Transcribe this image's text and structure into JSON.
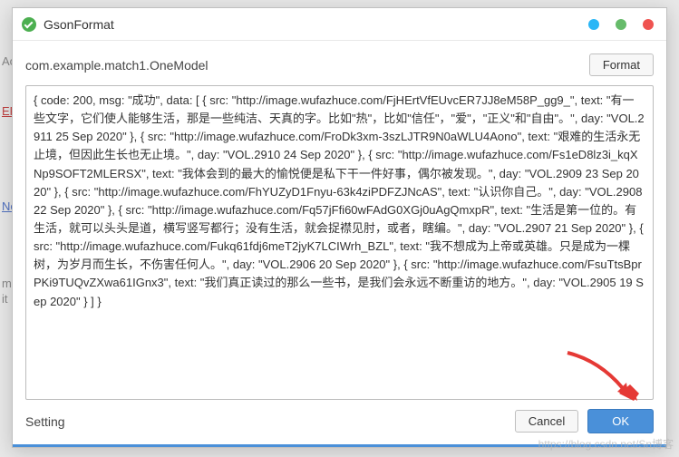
{
  "background": {
    "er": "ER",
    "nc": "Nc",
    "mx": "mx",
    "it": "it",
    "ao": "Ao"
  },
  "titlebar": {
    "title": "GsonFormat"
  },
  "header": {
    "class_label": "com.example.match1.OneModel",
    "format_button": "Format"
  },
  "json_text": "{ code: 200, msg: \"成功\", data: [ { src: \"http://image.wufazhuce.com/FjHErtVfEUvcER7JJ8eM58P_gg9_\", text: \"有一些文字，它们使人能够生活，那是一些纯洁、天真的字。比如\"热\"，比如\"信任\"，\"爱\"，\"正义\"和\"自由\"。\", day: \"VOL.2911 25 Sep 2020\" }, { src: \"http://image.wufazhuce.com/FroDk3xm-3szLJTR9N0aWLU4Aono\", text: \"艰难的生活永无止境，但因此生长也无止境。\", day: \"VOL.2910 24 Sep 2020\" }, { src: \"http://image.wufazhuce.com/Fs1eD8lz3i_kqXNp9SOFT2MLERSX\", text: \"我体会到的最大的愉悦便是私下干一件好事，偶尔被发现。\", day: \"VOL.2909 23 Sep 2020\" }, { src: \"http://image.wufazhuce.com/FhYUZyD1Fnyu-63k4ziPDFZJNcAS\", text: \"认识你自己。\", day: \"VOL.2908 22 Sep 2020\" }, { src: \"http://image.wufazhuce.com/Fq57jFfi60wFAdG0XGj0uAgQmxpR\", text: \"生活是第一位的。有生活，就可以头头是道，横写竖写都行；没有生活，就会捉襟见肘，或者，瞎编。\", day: \"VOL.2907 21 Sep 2020\" }, { src: \"http://image.wufazhuce.com/Fukq61fdj6meT2jyK7LCIWrh_BZL\", text: \"我不想成为上帝或英雄。只是成为一棵树，为岁月而生长，不伤害任何人。\", day: \"VOL.2906 20 Sep 2020\" }, { src: \"http://image.wufazhuce.com/FsuTtsBprPKi9TUQvZXwa61IGnx3\", text: \"我们真正读过的那么一些书，是我们会永远不断重访的地方。\", day: \"VOL.2905 19 Sep 2020\" } ] }",
  "footer": {
    "setting_label": "Setting",
    "cancel_label": "Cancel",
    "ok_label": "OK"
  },
  "watermark": "https://blog.csdn.net/Sn博客"
}
